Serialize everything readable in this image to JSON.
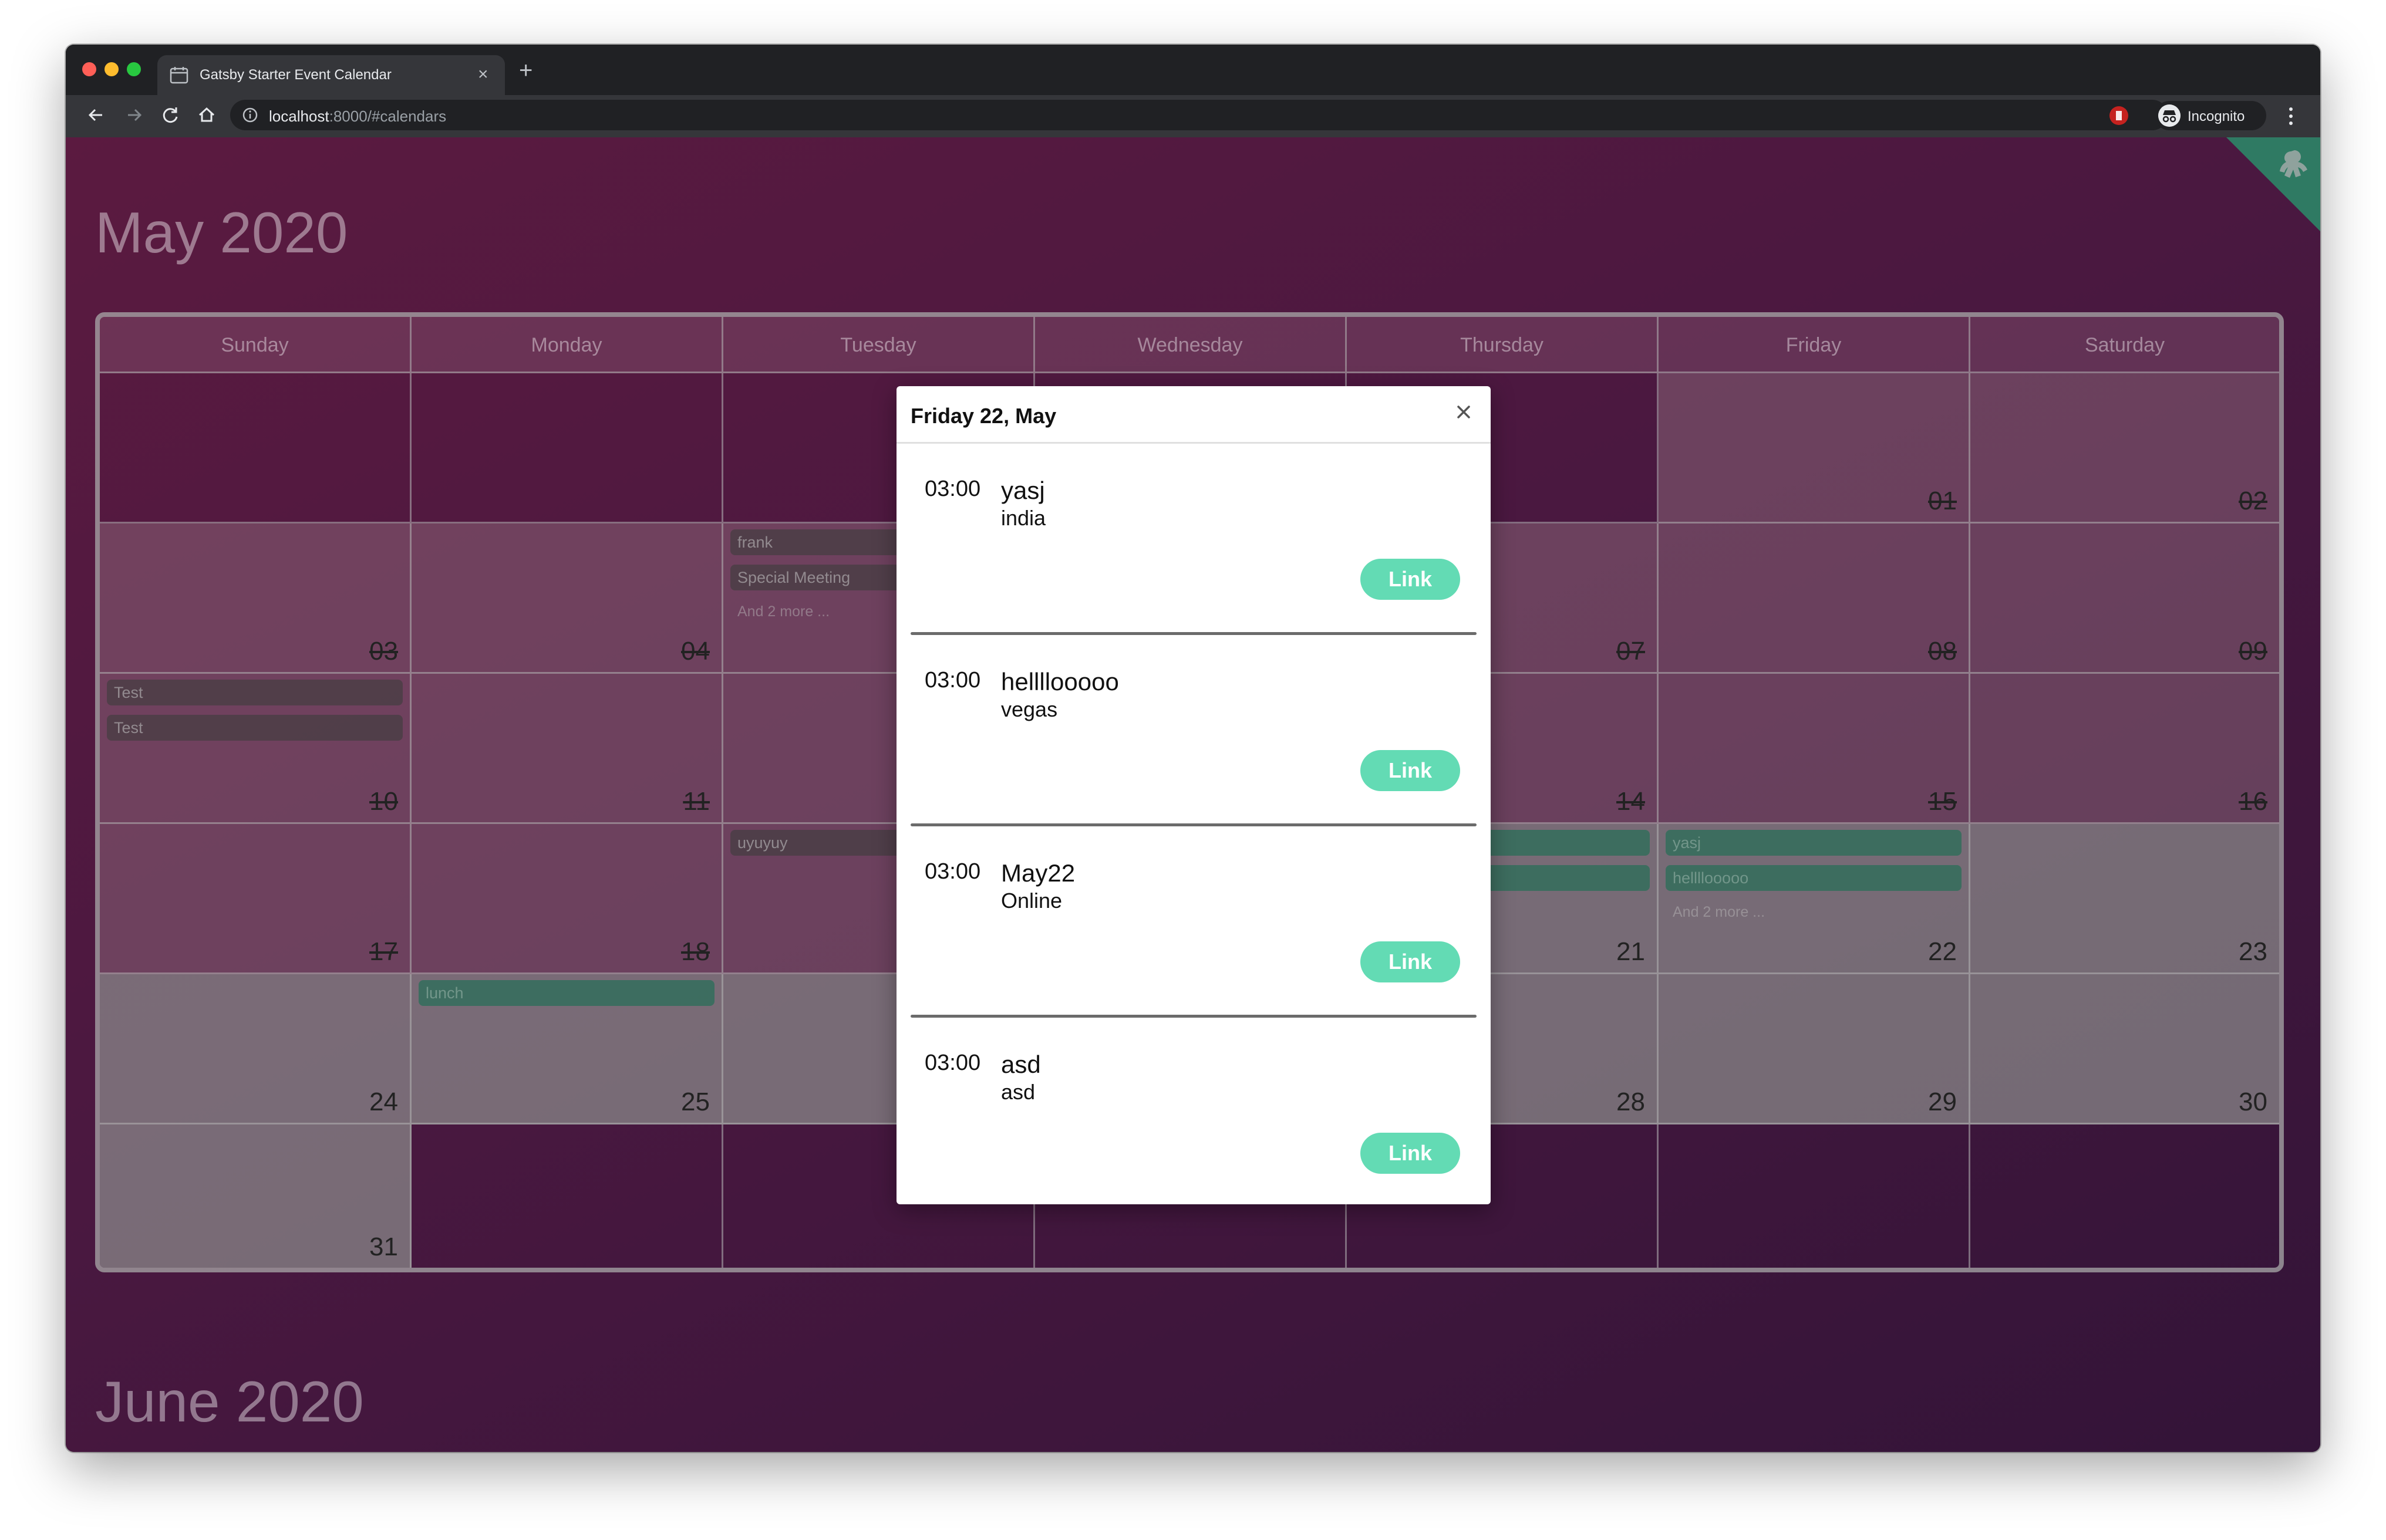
{
  "browser": {
    "tab_title": "Gatsby Starter Event Calendar",
    "tab_close": "×",
    "new_tab": "+",
    "url_host": "localhost",
    "url_rest": ":8000/#calendars",
    "profile_label": "Incognito"
  },
  "calendar_may": {
    "title": "May 2020",
    "weekdays": [
      "Sunday",
      "Monday",
      "Tuesday",
      "Wednesday",
      "Thursday",
      "Friday",
      "Saturday"
    ],
    "cells": {
      "c1_5": "01",
      "c1_6": "02",
      "c2_0": "03",
      "c2_1": "04",
      "c2_4": "07",
      "c2_5": "08",
      "c2_6": "09",
      "c3_0": "10",
      "c3_1": "11",
      "c3_4": "14",
      "c3_5": "15",
      "c3_6": "16",
      "c4_0": "17",
      "c4_1": "18",
      "c4_4": "21",
      "c4_5": "22",
      "c4_6": "23",
      "c5_0": "24",
      "c5_1": "25",
      "c5_4": "28",
      "c5_5": "29",
      "c5_6": "30",
      "c6_0": "31"
    },
    "events": {
      "tue5_1": "frank",
      "tue5_2": "Special Meeting",
      "tue5_more": "And 2 more ...",
      "sun10_1": "Test",
      "sun10_2": "Test",
      "tue19_1": "uyuyuy",
      "fri22_1": "yasj",
      "fri22_2": "hellllooooo",
      "fri22_more": "And 2 more ...",
      "mon25_1": "lunch"
    }
  },
  "calendar_june": {
    "title": "June 2020"
  },
  "modal": {
    "title": "Friday 22, May",
    "close": "×",
    "events": [
      {
        "time": "03:00",
        "name": "yasj",
        "location": "india",
        "button": "Link"
      },
      {
        "time": "03:00",
        "name": "hellllooooo",
        "location": "vegas",
        "button": "Link"
      },
      {
        "time": "03:00",
        "name": "May22",
        "location": "Online",
        "button": "Link"
      },
      {
        "time": "03:00",
        "name": "asd",
        "location": "asd",
        "button": "Link"
      }
    ]
  }
}
